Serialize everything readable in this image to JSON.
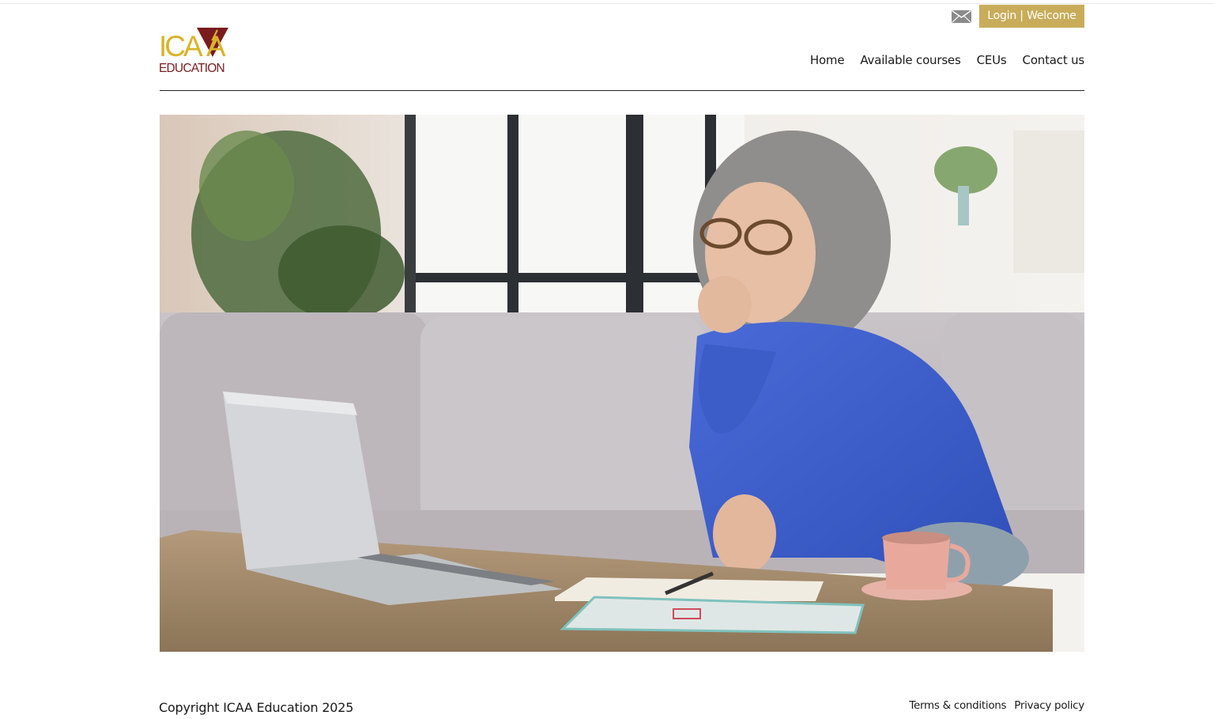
{
  "utility": {
    "mail_icon": "envelope-icon",
    "login_label": "Login | Welcome"
  },
  "logo": {
    "alt_text_top": "ICAA",
    "alt_text_bottom": "EDUCATION"
  },
  "nav": {
    "items": [
      {
        "label": "Home"
      },
      {
        "label": "Available courses"
      },
      {
        "label": "CEUs"
      },
      {
        "label": "Contact us"
      }
    ]
  },
  "footer": {
    "copyright": "Copyright ICAA Education 2025",
    "links": [
      {
        "label": "Terms & conditions"
      },
      {
        "label": "Privacy policy"
      }
    ]
  },
  "colors": {
    "accent_gold": "#c8ac5a",
    "logo_gold": "#d9b32a",
    "logo_maroon": "#7a1b1e"
  }
}
